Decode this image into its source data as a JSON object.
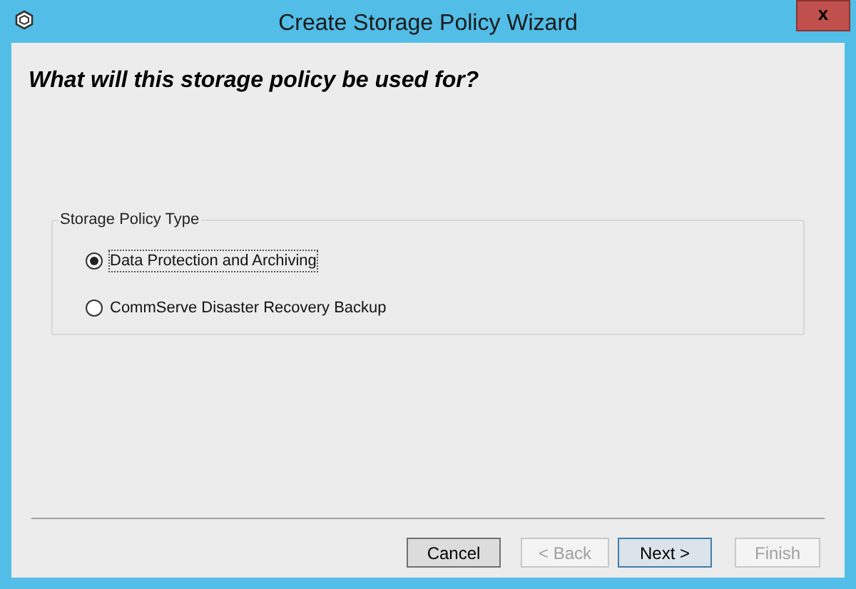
{
  "window": {
    "title": "Create Storage Policy Wizard",
    "close": "x"
  },
  "heading": "What will this storage policy be used for?",
  "group": {
    "label": "Storage Policy Type",
    "options": [
      {
        "label": "Data Protection and Archiving",
        "selected": true
      },
      {
        "label": "CommServe Disaster Recovery Backup",
        "selected": false
      }
    ]
  },
  "buttons": [
    {
      "label": "Cancel",
      "disabled": false,
      "default": false
    },
    {
      "label": "< Back",
      "disabled": true,
      "default": false
    },
    {
      "label": "Next >",
      "disabled": false,
      "default": true
    },
    {
      "label": "Finish",
      "disabled": true,
      "default": false
    }
  ]
}
